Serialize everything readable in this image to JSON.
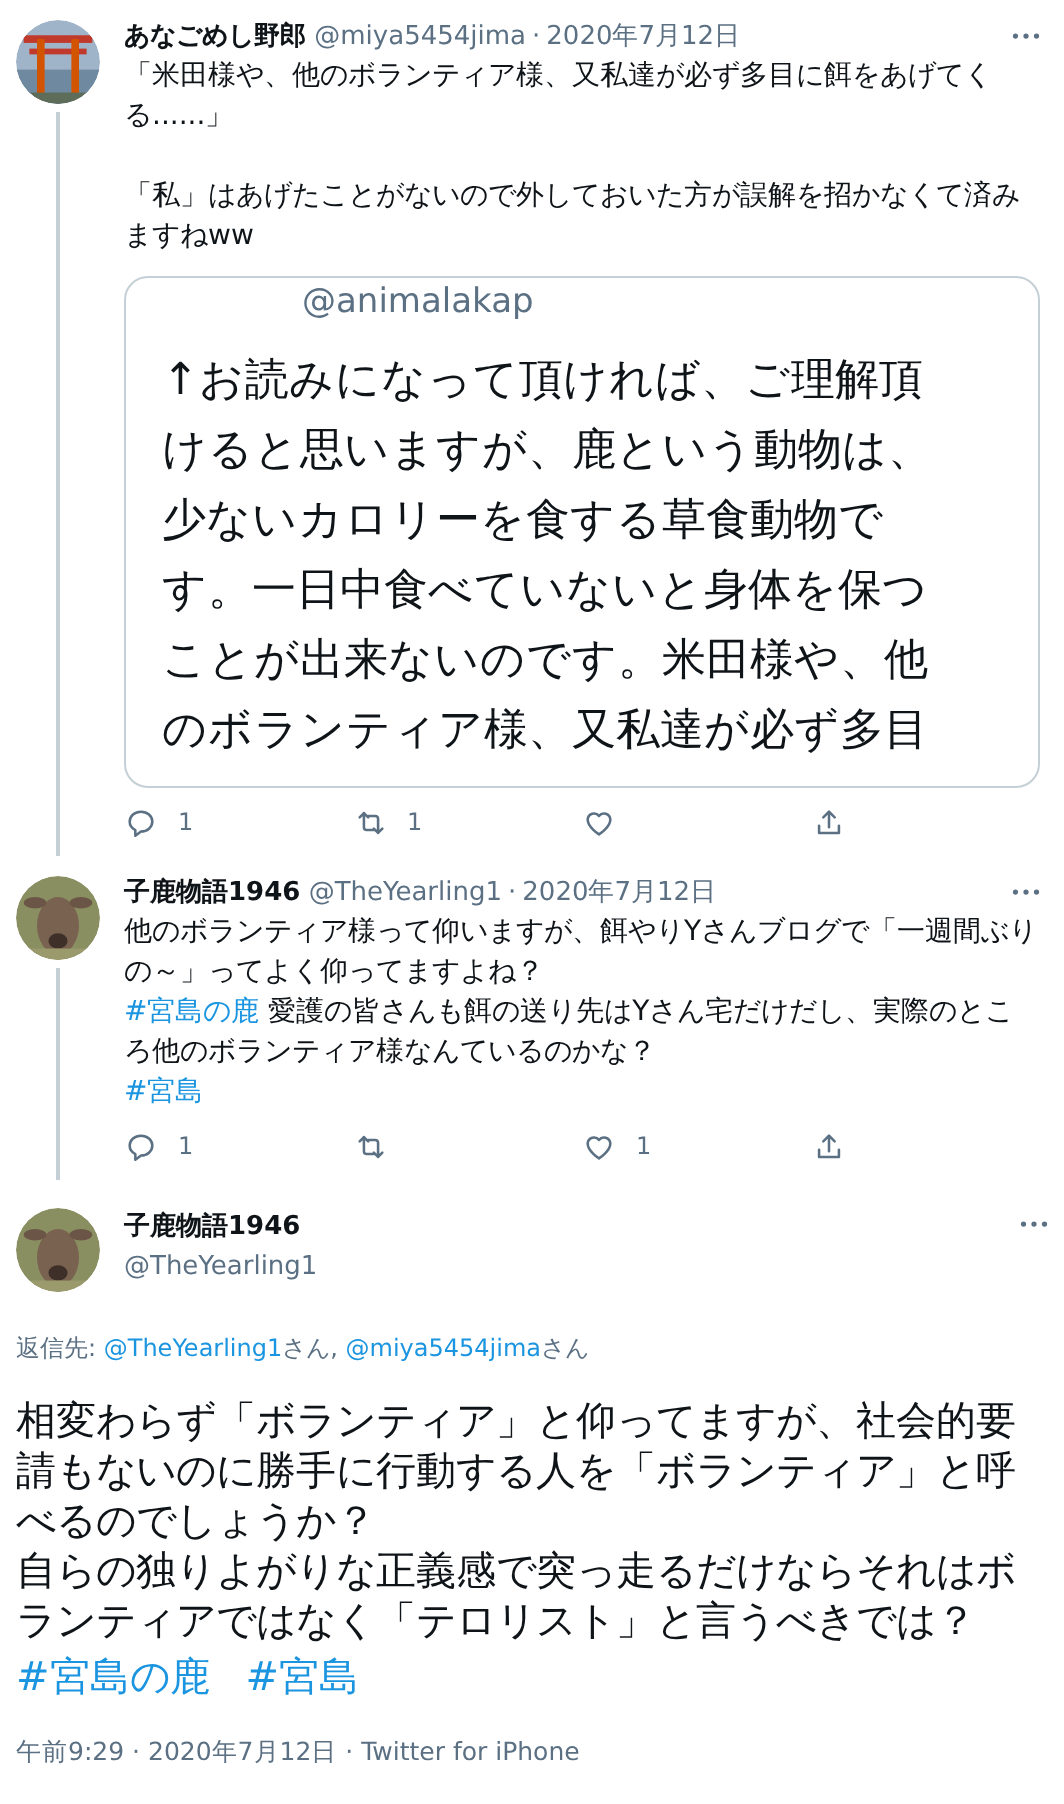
{
  "thread": [
    {
      "name": "あなごめし野郎",
      "handle": "@miya5454jima",
      "separator": "·",
      "date": "2020年7月12日",
      "avatar": {
        "kind": "picture"
      },
      "paragraphs": [
        {
          "spaced": false,
          "segments": [
            {
              "kind": "text",
              "text": "「米田様や、他のボランティア様、又私達が必ず多目に餌をあげてくる......」"
            }
          ]
        },
        {
          "spaced": true,
          "segments": [
            {
              "kind": "text",
              "text": "「私」はあげたことがないので外しておいた方が誤解を招かなくて済みますねww"
            }
          ]
        }
      ],
      "attachment": {
        "handle": "@animalakap",
        "lines": [
          "↑お読みになって頂ければ、ご理解頂",
          "けると思いますが、鹿という動物は、",
          "少ないカロリーを食する草食動物で",
          "す。一日中食べていないと身体を保つ",
          "ことが出来ないのです。米田様や、他",
          "のボランティア様、又私達が必ず多目"
        ]
      },
      "actions": {
        "replies": "1",
        "retweets": "1"
      }
    },
    {
      "name": "子鹿物語1946",
      "handle": "@TheYearling1",
      "separator": "·",
      "date": "2020年7月12日",
      "avatar": {
        "kind": "picture"
      },
      "paragraphs": [
        {
          "spaced": false,
          "segments": [
            {
              "kind": "text",
              "text": "他のボランティア様って仰いますが、餌やりYさんブログで「一週間ぶりの～」ってよく仰ってますよね？"
            }
          ]
        },
        {
          "spaced": false,
          "segments": [
            {
              "kind": "hashtag",
              "text": "#宮島の鹿"
            },
            {
              "kind": "text",
              "text": " 愛護の皆さんも餌の送り先はYさん宅だけだし、実際のところ他のボランティア様なんているのかな？"
            }
          ]
        },
        {
          "spaced": false,
          "segments": [
            {
              "kind": "hashtag",
              "text": "#宮島"
            }
          ]
        }
      ],
      "actions": {
        "replies": "1",
        "likes": "1"
      }
    }
  ],
  "main": {
    "avatar": {
      "kind": "picture"
    },
    "name": "子鹿物語1946",
    "handle": "@TheYearling1",
    "reply_label": "返信先:",
    "reply_to": [
      {
        "handle": "@TheYearling1",
        "suffix": "さん",
        "sep": ", "
      },
      {
        "handle": "@miya5454jima",
        "suffix": "さん"
      }
    ],
    "lines": [
      "相変わらず「ボランティア」と仰ってますが、社会的要請もないのに勝手に行動する人を「ボランティア」と呼べるのでしょうか？",
      "自らの独りよがりな正義感で突っ走るだけならそれはボランティアではなく「テロリスト」と言うべきでは？"
    ],
    "hashtags": [
      "#宮島の鹿",
      "#宮島"
    ],
    "meta": "午前9:29 · 2020年7月12日 · Twitter for iPhone"
  }
}
